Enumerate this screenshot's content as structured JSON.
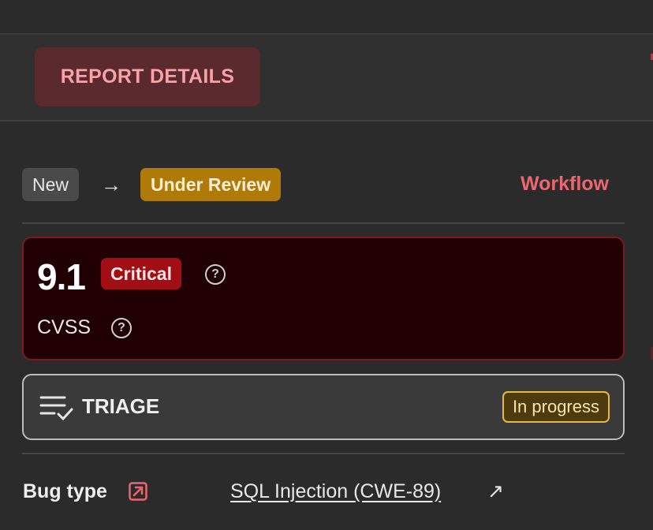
{
  "tabs": {
    "active_label": "REPORT DETAILS"
  },
  "workflow": {
    "from_state": "New",
    "arrow": "→",
    "to_state": "Under Review",
    "link_label": "Workflow"
  },
  "score": {
    "value": "9.1",
    "severity": "Critical",
    "help_glyph": "?",
    "metric_label": "CVSS"
  },
  "triage": {
    "icon": "checklist-icon",
    "label": "TRIAGE",
    "status": "In progress"
  },
  "bug": {
    "label": "Bug type",
    "label_icon": "external-link-icon",
    "value": "SQL Injection (CWE-89)",
    "value_arrow": "↗"
  },
  "colors": {
    "accent": "#ec6672",
    "critical": "#a10f14",
    "review": "#b07a09",
    "progress_border": "#e8b83e"
  }
}
